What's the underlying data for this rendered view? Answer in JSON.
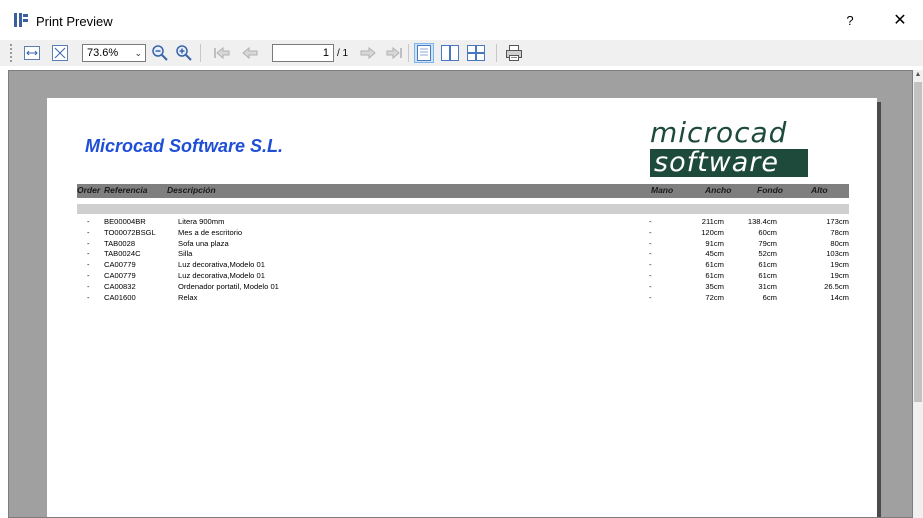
{
  "window": {
    "title": "Print Preview",
    "help": "?",
    "close": "✕"
  },
  "toolbar": {
    "zoom_value": "73.6%",
    "page_current": "1",
    "page_total": "/ 1"
  },
  "report": {
    "company": "Microcad Software S.L.",
    "logo_line1": "microcad",
    "logo_line2": "software",
    "columns": {
      "order": "Order",
      "ref": "Referencia",
      "desc": "Descripción",
      "mano": "Mano",
      "ancho": "Ancho",
      "fondo": "Fondo",
      "alto": "Alto"
    },
    "rows": [
      {
        "order": "-",
        "ref": "BE00004BR",
        "desc": "Litera 900mm",
        "mano": "-",
        "ancho": "211cm",
        "fondo": "138.4cm",
        "alto": "173cm"
      },
      {
        "order": "-",
        "ref": "TO00072BSGL",
        "desc": "Mes a de escritorio",
        "mano": "-",
        "ancho": "120cm",
        "fondo": "60cm",
        "alto": "78cm"
      },
      {
        "order": "-",
        "ref": "TAB0028",
        "desc": "Sofa una plaza",
        "mano": "-",
        "ancho": "91cm",
        "fondo": "79cm",
        "alto": "80cm"
      },
      {
        "order": "-",
        "ref": "TAB0024C",
        "desc": "Silla",
        "mano": "-",
        "ancho": "45cm",
        "fondo": "52cm",
        "alto": "103cm"
      },
      {
        "order": "-",
        "ref": "CA00779",
        "desc": "Luz decorativa,Modelo 01",
        "mano": "-",
        "ancho": "61cm",
        "fondo": "61cm",
        "alto": "19cm"
      },
      {
        "order": "-",
        "ref": "CA00779",
        "desc": "Luz decorativa,Modelo 01",
        "mano": "-",
        "ancho": "61cm",
        "fondo": "61cm",
        "alto": "19cm"
      },
      {
        "order": "-",
        "ref": "CA00832",
        "desc": "Ordenador portatil, Modelo 01",
        "mano": "-",
        "ancho": "35cm",
        "fondo": "31cm",
        "alto": "26.5cm"
      },
      {
        "order": "-",
        "ref": "CA01600",
        "desc": "Relax",
        "mano": "-",
        "ancho": "72cm",
        "fondo": "6cm",
        "alto": "14cm"
      }
    ]
  },
  "colors": {
    "accent": "#1f4fd6",
    "logo": "#1d4a3a",
    "header_bar": "#7f7f7f",
    "viewport": "#a0a0a0"
  }
}
